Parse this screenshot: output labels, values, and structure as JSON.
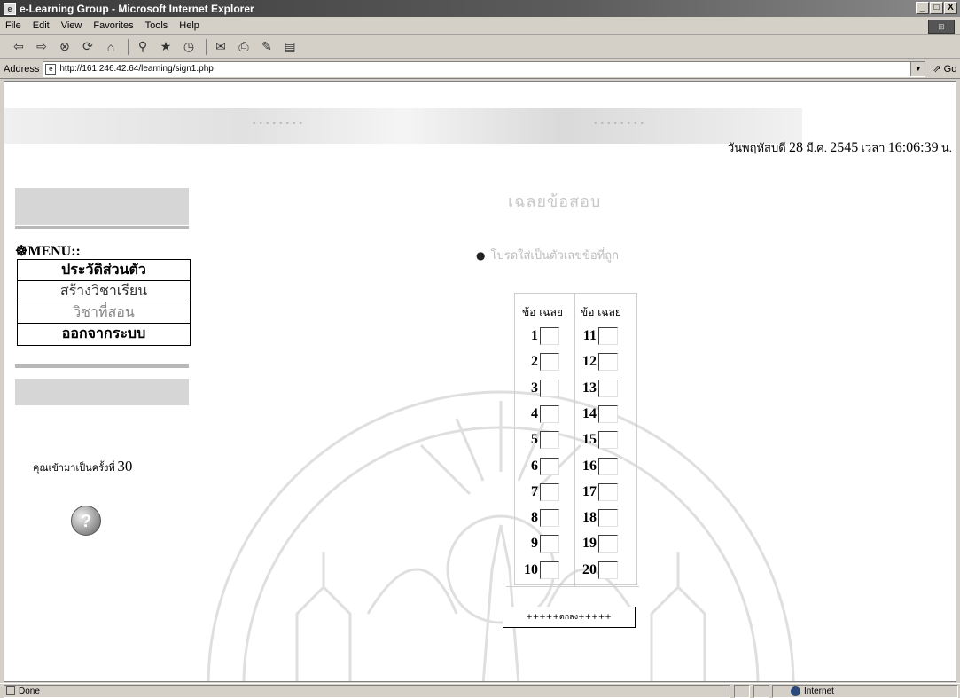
{
  "window": {
    "title": "e-Learning Group - Microsoft Internet Explorer",
    "buttons": [
      "_",
      "□",
      "X"
    ]
  },
  "menubar": [
    "File",
    "Edit",
    "View",
    "Favorites",
    "Tools",
    "Help"
  ],
  "address": {
    "label": "Address",
    "url": "http://161.246.42.64/learning/sign1.php",
    "go_label": "Go"
  },
  "page": {
    "date_prefix": "วันพฤหัสบดี",
    "date_day": "28",
    "date_month": "มี.ค.",
    "date_year": "2545",
    "time_prefix": "เวลา",
    "time": "16:06:39",
    "time_suffix": "น.",
    "heading": "เฉลยข้อสอบ",
    "instruction": "โปรดใส่เป็นตัวเลขข้อที่ถูก",
    "menu_label": "MENU::",
    "menu_items": [
      "ประวัติส่วนตัว",
      "สร้างวิชาเรียน",
      "วิชาที่สอน",
      "ออกจากระบบ"
    ],
    "visit_text": "คุณเข้ามาเป็นครั้งที่",
    "visit_count": "30",
    "col_header": "ข้อ เฉลย",
    "questions_left": [
      "1",
      "2",
      "3",
      "4",
      "5",
      "6",
      "7",
      "8",
      "9",
      "10"
    ],
    "questions_right": [
      "11",
      "12",
      "13",
      "14",
      "15",
      "16",
      "17",
      "18",
      "19",
      "20"
    ],
    "submit_label": "+++++ตกลง+++++"
  },
  "status": {
    "text": "Done",
    "zone": "Internet"
  }
}
